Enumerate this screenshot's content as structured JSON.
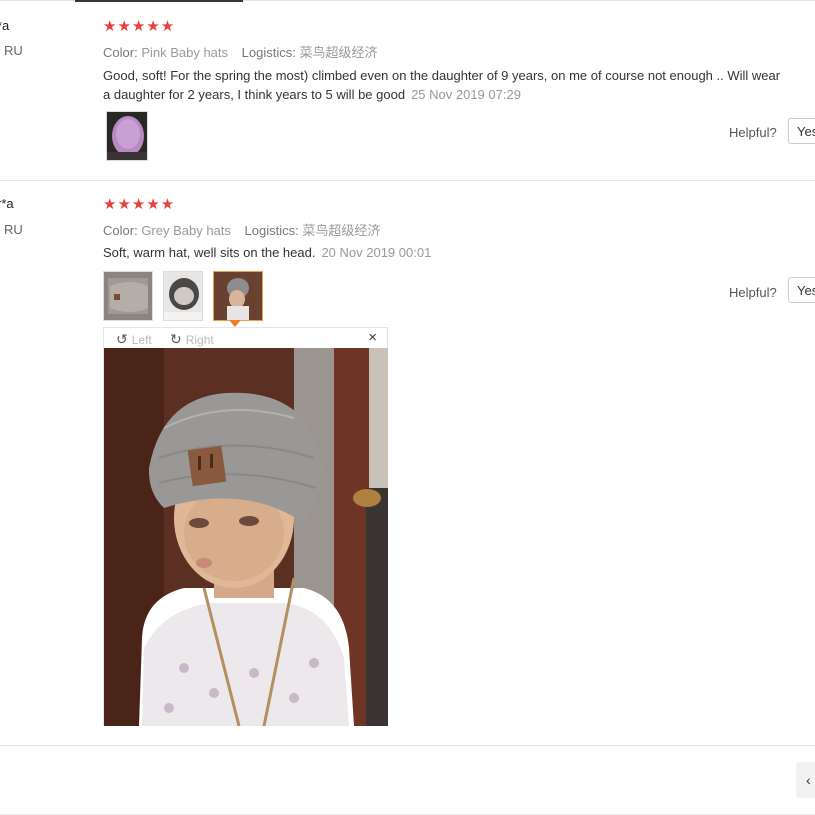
{
  "reviews": [
    {
      "user": "*a",
      "country": "RU",
      "stars": "★★★★★",
      "color_label": "Color:",
      "color_value": "Pink Baby hats",
      "logistics_label": "Logistics:",
      "logistics_value": "菜鸟超级经济",
      "text_line1": "Good, soft! For the spring the most) climbed even on the daughter of 9 years, on me of course not enough .. Will wear",
      "text_line2": "a daughter for 2 years, I think years to 5 will be good",
      "date": "25 Nov 2019 07:29",
      "helpful_label": "Helpful?",
      "yes_label": "Yes"
    },
    {
      "user": "r*a",
      "country": "RU",
      "stars": "★★★★★",
      "color_label": "Color:",
      "color_value": "Grey Baby hats",
      "logistics_label": "Logistics:",
      "logistics_value": "菜鸟超级经济",
      "text_line1": "Soft, warm hat, well sits on the head.",
      "date": "20 Nov 2019 00:01",
      "helpful_label": "Helpful?",
      "yes_label": "Yes"
    }
  ],
  "viewer": {
    "rotate_left_label": "Left",
    "rotate_right_label": "Right",
    "close_symbol": "×"
  },
  "pager": {
    "prev_symbol": "‹"
  },
  "colors": {
    "star": "#e8403a",
    "active_thumb": "#e0a050",
    "marker": "#e8832a"
  }
}
